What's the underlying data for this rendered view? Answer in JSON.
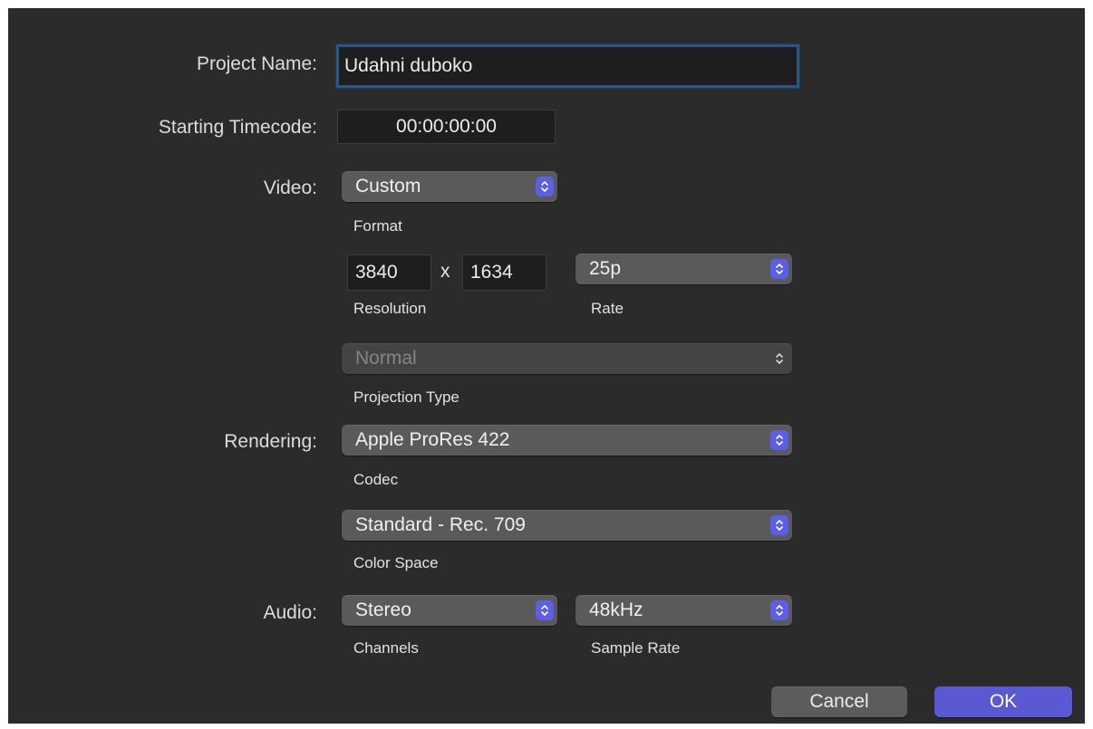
{
  "project_name": {
    "label": "Project Name:",
    "value": "Udahni duboko"
  },
  "starting_timecode": {
    "label": "Starting Timecode:",
    "value": "00:00:00:00"
  },
  "video": {
    "label": "Video:",
    "format": {
      "value": "Custom",
      "caption": "Format"
    },
    "resolution": {
      "width": "3840",
      "separator": "x",
      "height": "1634",
      "caption": "Resolution"
    },
    "rate": {
      "value": "25p",
      "caption": "Rate"
    },
    "projection": {
      "value": "Normal",
      "caption": "Projection Type"
    }
  },
  "rendering": {
    "label": "Rendering:",
    "codec": {
      "value": "Apple ProRes 422",
      "caption": "Codec"
    },
    "color_space": {
      "value": "Standard - Rec. 709",
      "caption": "Color Space"
    }
  },
  "audio": {
    "label": "Audio:",
    "channels": {
      "value": "Stereo",
      "caption": "Channels"
    },
    "sample_rate": {
      "value": "48kHz",
      "caption": "Sample Rate"
    }
  },
  "buttons": {
    "cancel": "Cancel",
    "ok": "OK"
  },
  "colors": {
    "background": "#2b2b2b",
    "accent": "#5d5ee8",
    "focus_ring": "#2c5583"
  },
  "icons": {
    "popup_arrows": "updown-chevron-icon"
  }
}
